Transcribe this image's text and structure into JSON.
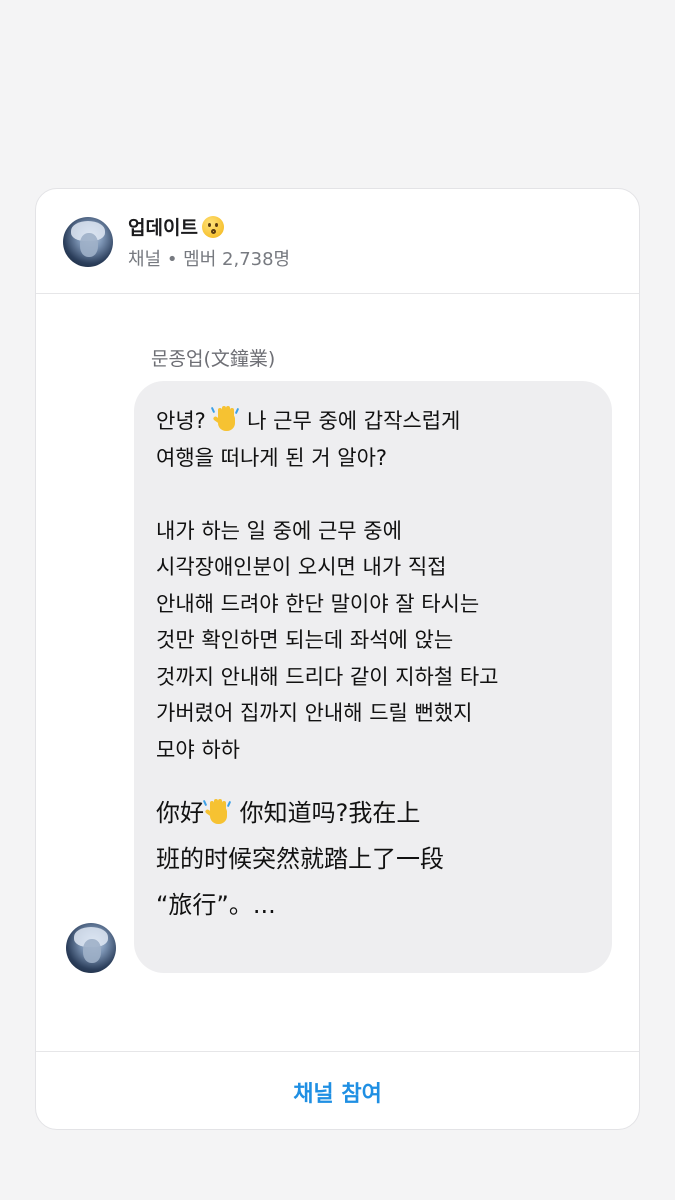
{
  "channel": {
    "title": "업데이트",
    "title_emoji": "kissing-face-icon",
    "meta": "채널 • 멤버 2,738명"
  },
  "message": {
    "sender": "문종업(文鐘業)",
    "korean_line1_before_emoji": "안녕? ",
    "korean_line1_after_emoji": " 나 근무 중에 갑작스럽게\n여행을 떠나게 된 거 알아?\n\n내가 하는 일 중에 근무 중에\n시각장애인분이 오시면 내가 직접\n안내해 드려야 한단 말이야 잘 타시는\n것만 확인하면 되는데 좌석에 앉는\n것까지 안내해 드리다 같이 지하철 타고\n가버렸어 집까지 안내해 드릴 뻔했지\n모야 하하",
    "chinese_before_emoji": "你好",
    "chinese_after_emoji": " 你知道吗?我在上\n班的时候突然就踏上了一段\n“旅行”。...",
    "emoji": "waving-hand-icon"
  },
  "footer": {
    "join_label": "채널 참여"
  },
  "colors": {
    "accent": "#1f8fe3",
    "bubble": "#eeeef0",
    "background": "#f4f4f5"
  }
}
